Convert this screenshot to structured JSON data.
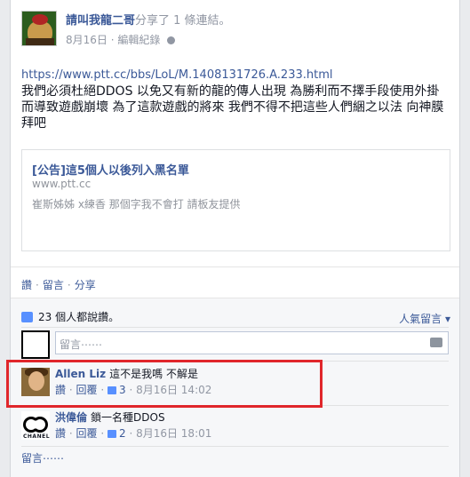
{
  "post": {
    "poster_name": "請叫我龍二哥",
    "action_text": "分享了 1 條連結。",
    "date": "8月16日",
    "edit_history": "編輯紀錄",
    "link_text": "https://www.ptt.cc/bbs/LoL/M.1408131726.A.233.html",
    "message": "我們必須杜絕DDOS 以免又有新的龍的傳人出現 為勝利而不擇手段使用外掛 而導致遊戲崩壞 為了這款遊戲的將來 我們不得不把這些人們綑之以法 向神膜拜吧"
  },
  "shared_link": {
    "title": "[公告]這5個人以後列入黑名單",
    "url": "www.ptt.cc",
    "description": "崔斯姊姊 x練香 那個字我不會打 請板友提供"
  },
  "actions": {
    "like": "讚",
    "comment": "留言",
    "share": "分享",
    "separator": "·"
  },
  "feedback": {
    "likes_text": "23 個人都說讚。",
    "sort_label": "人氣留言 ▾",
    "comment_placeholder": "留言⋯⋯",
    "more_comments": "留言⋯⋯"
  },
  "comments": [
    {
      "name": "Allen Liz",
      "text": "這不是我嗎 不解是",
      "like_label": "讚",
      "reply_label": "回覆",
      "like_count": "3",
      "timestamp": "8月16日 14:02"
    },
    {
      "name": "洪偉倫",
      "text": "鎖一名種DDOS",
      "like_label": "讚",
      "reply_label": "回覆",
      "like_count": "2",
      "timestamp": "8月16日 18:01"
    }
  ],
  "colors": {
    "link_blue": "#3b5998",
    "highlight_red": "#e0262b"
  }
}
